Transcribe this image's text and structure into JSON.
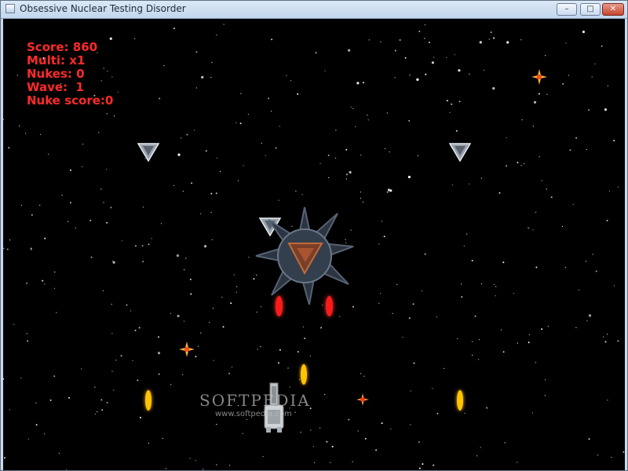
{
  "window": {
    "title": "Obsessive Nuclear Testing Disorder",
    "controls": {
      "minimize": "–",
      "maximize": "□",
      "close": "✕"
    }
  },
  "hud": {
    "score": "Score: 860",
    "multi": "Multi: x1",
    "nukes": "Nukes: 0",
    "wave": "Wave:  1",
    "nuke_score": "Nuke score:0"
  },
  "colors": {
    "hud_text": "#ff2a2a",
    "enemy_bullet": "#ff1a1a",
    "player_bullet": "#ffc400",
    "background": "#000000"
  },
  "icons": {
    "app": "app-window-icon",
    "enemy": "triangular-enemy-ship-icon",
    "boss": "spiked-boss-ship-icon",
    "player": "player-ship-icon",
    "spark": "explosion-spark-icon"
  },
  "watermark": {
    "brand": "SOFTPEDIA",
    "url": "www.softpedia.com"
  }
}
